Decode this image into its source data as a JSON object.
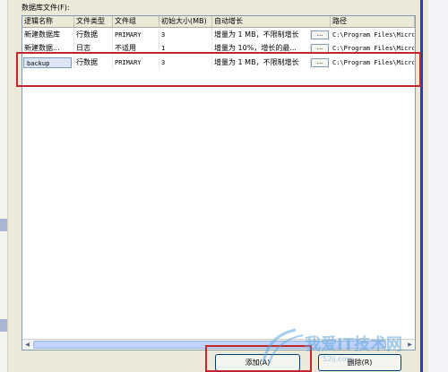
{
  "files_label": "数据库文件(F):",
  "columns": [
    "逻辑名称",
    "文件类型",
    "文件组",
    "初始大小(MB)",
    "自动增长",
    "路径"
  ],
  "rows": [
    {
      "name": "新建数据库",
      "type": "行数据",
      "group": "PRIMARY",
      "size": "3",
      "growth": "增量为 1 MB，不限制增长",
      "browse": "...",
      "path": "C:\\Program Files\\Micro"
    },
    {
      "name": "新建数据...",
      "type": "日志",
      "group": "不适用",
      "size": "1",
      "growth": "增量为 10%，增长的最...",
      "browse": "...",
      "path": "C:\\Program Files\\Micro"
    },
    {
      "name": "backup",
      "type": "行数据",
      "group": "PRIMARY",
      "size": "3",
      "growth": "增量为 1 MB，不限制增长",
      "browse": "...",
      "path": "C:\\Program Files\\Micro"
    }
  ],
  "buttons": {
    "add": "添加(A)",
    "remove": "删除(R)"
  },
  "watermark": {
    "title": "我爱IT技术网",
    "sub": "52ij.com"
  },
  "colors": {
    "highlight": "#c0282d",
    "edit": "#dce6f4"
  }
}
